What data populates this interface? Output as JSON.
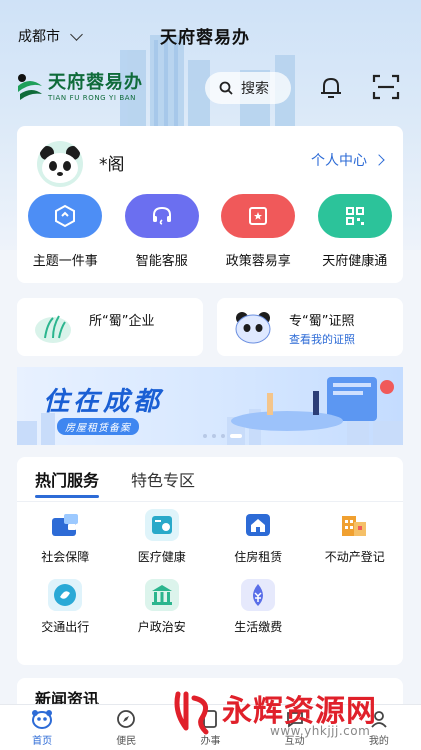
{
  "header": {
    "city": "成都市",
    "app_title": "天府蓉易办",
    "brand_cn": "天府蓉易办",
    "brand_en": "TIAN FU RONG YI BAN",
    "search_label": "搜索"
  },
  "user": {
    "name": "*阁",
    "personal_center": "个人中心"
  },
  "quick_actions": [
    {
      "label": "主题一件事",
      "color": "#4d8ef5"
    },
    {
      "label": "智能客服",
      "color": "#6b6ff0"
    },
    {
      "label": "政策蓉易享",
      "color": "#f0595a"
    },
    {
      "label": "天府健康通",
      "color": "#2cc39a"
    }
  ],
  "enterprise": {
    "title": "所“蜀”企业"
  },
  "certificate": {
    "title": "专“蜀”证照",
    "link": "查看我的证照"
  },
  "banner": {
    "title": "住在成都",
    "subtitle": "房屋租赁备案"
  },
  "services": {
    "tabs": [
      "热门服务",
      "特色专区"
    ],
    "items": [
      {
        "label": "社会保障",
        "icon": "wallet-icon",
        "color": "#2d6bd6"
      },
      {
        "label": "医疗健康",
        "icon": "medical-card-icon",
        "color": "#2aa9c9"
      },
      {
        "label": "住房租赁",
        "icon": "house-icon",
        "color": "#2d6bd6"
      },
      {
        "label": "不动产登记",
        "icon": "building-icon",
        "color": "#f0a030"
      },
      {
        "label": "交通出行",
        "icon": "transport-icon",
        "color": "#2aa9d6"
      },
      {
        "label": "户政治安",
        "icon": "government-icon",
        "color": "#2bb58e"
      },
      {
        "label": "生活缴费",
        "icon": "yen-drop-icon",
        "color": "#5a6ee8"
      }
    ]
  },
  "news": {
    "title": "新闻资讯"
  },
  "bottom_nav": [
    {
      "label": "首页",
      "active": true
    },
    {
      "label": "便民",
      "active": false
    },
    {
      "label": "办事",
      "active": false
    },
    {
      "label": "互动",
      "active": false
    },
    {
      "label": "我的",
      "active": false
    }
  ],
  "watermark": {
    "text": "永辉资源网",
    "url": "www.yhkjjj.com"
  }
}
